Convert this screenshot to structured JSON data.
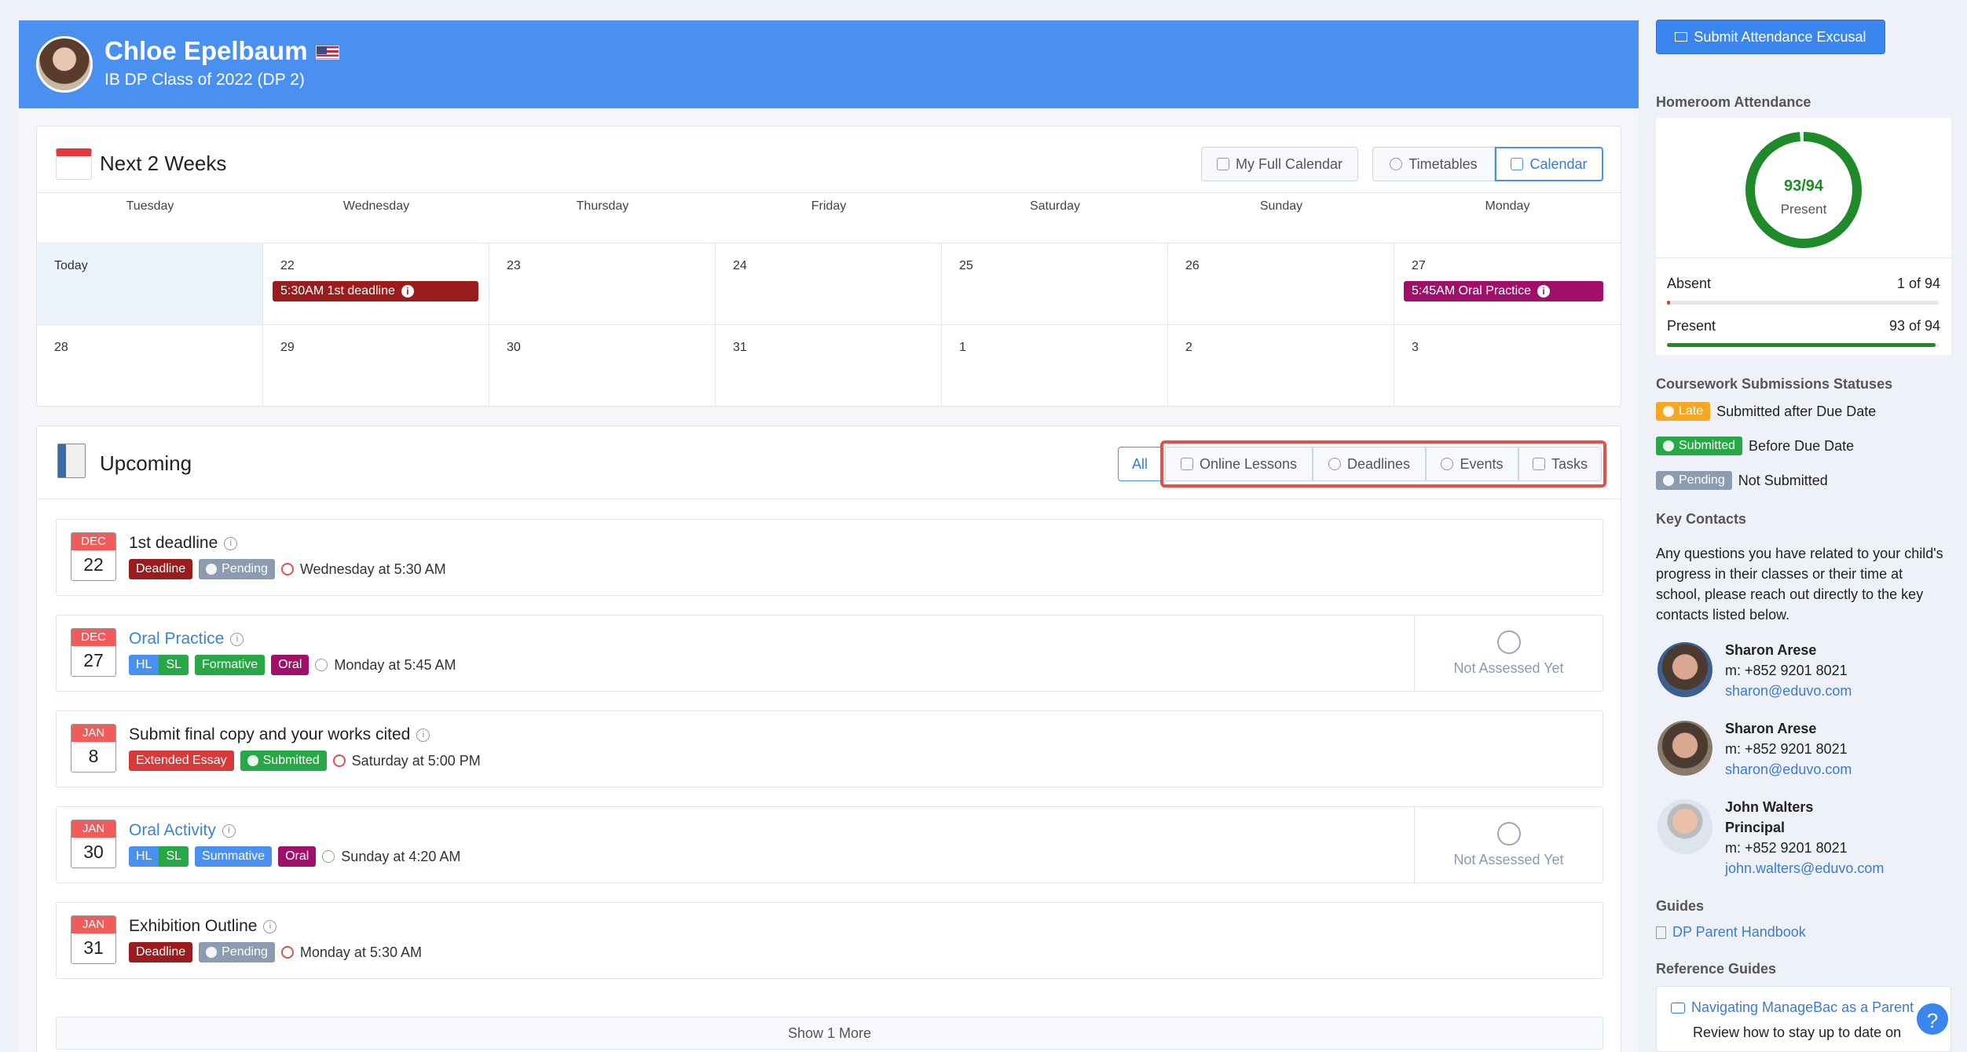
{
  "student": {
    "name": "Chloe Epelbaum",
    "class": "IB DP Class of 2022 (DP 2)"
  },
  "calendar": {
    "title": "Next 2 Weeks",
    "buttons": {
      "full_calendar": "My Full Calendar",
      "timetables": "Timetables",
      "calendar": "Calendar"
    },
    "days": [
      "Tuesday",
      "Wednesday",
      "Thursday",
      "Friday",
      "Saturday",
      "Sunday",
      "Monday"
    ],
    "week1": [
      "Today",
      "22",
      "23",
      "24",
      "25",
      "26",
      "27"
    ],
    "week2": [
      "28",
      "29",
      "30",
      "31",
      "1",
      "2",
      "3"
    ],
    "events": [
      {
        "label": "5:30AM 1st deadline",
        "color": "#9b1c1c"
      },
      {
        "label": "5:45AM Oral Practice",
        "color": "#a0106a"
      }
    ]
  },
  "upcoming": {
    "title": "Upcoming",
    "filters": {
      "all": "All",
      "online": "Online Lessons",
      "deadlines": "Deadlines",
      "events": "Events",
      "tasks": "Tasks"
    },
    "items": [
      {
        "month": "DEC",
        "day": "22",
        "title": "1st deadline",
        "tags": [
          "Deadline",
          "Pending"
        ],
        "when": "Wednesday at 5:30 AM"
      },
      {
        "month": "DEC",
        "day": "27",
        "title": "Oral Practice",
        "tags": [
          "HL",
          "SL",
          "Formative",
          "Oral"
        ],
        "when": "Monday at 5:45 AM",
        "status": "Not Assessed Yet"
      },
      {
        "month": "JAN",
        "day": "8",
        "title": "Submit final copy and your works cited",
        "tags": [
          "Extended Essay",
          "Submitted"
        ],
        "when": "Saturday at 5:00 PM"
      },
      {
        "month": "JAN",
        "day": "30",
        "title": "Oral Activity",
        "tags": [
          "HL",
          "SL",
          "Summative",
          "Oral"
        ],
        "when": "Sunday at 4:20 AM",
        "status": "Not Assessed Yet"
      },
      {
        "month": "JAN",
        "day": "31",
        "title": "Exhibition Outline",
        "tags": [
          "Deadline",
          "Pending"
        ],
        "when": "Monday at 5:30 AM"
      }
    ],
    "show_more": "Show 1 More"
  },
  "sidebar": {
    "submit_btn": "Submit Attendance Excusal",
    "attendance": {
      "heading": "Homeroom Attendance",
      "ratio": "93/94",
      "ratio_label": "Present",
      "present_fraction": 0.989,
      "absent_label": "Absent",
      "absent_value": "1 of 94",
      "present_label": "Present",
      "present_value": "93 of 94"
    },
    "coursework": {
      "heading": "Coursework Submissions Statuses",
      "rows": [
        {
          "badge": "Late",
          "text": "Submitted after Due Date",
          "color": "#f5a623"
        },
        {
          "badge": "Submitted",
          "text": "Before Due Date",
          "color": "#27a745"
        },
        {
          "badge": "Pending",
          "text": "Not Submitted",
          "color": "#8c9bb0"
        }
      ]
    },
    "contacts": {
      "heading": "Key Contacts",
      "intro": "Any questions you have related to your child's progress in their classes or their time at school, please reach out directly to the key contacts listed below.",
      "people": [
        {
          "name": "Sharon Arese",
          "role": "",
          "phone": "m: +852 9201 8021",
          "email": "sharon@eduvo.com"
        },
        {
          "name": "Sharon Arese",
          "role": "",
          "phone": "m: +852 9201 8021",
          "email": "sharon@eduvo.com"
        },
        {
          "name": "John Walters",
          "role": "Principal",
          "phone": "m: +852 9201 8021",
          "email": "john.walters@eduvo.com"
        }
      ]
    },
    "guides": {
      "heading": "Guides",
      "link": "DP Parent Handbook"
    },
    "reference": {
      "heading": "Reference Guides",
      "link": "Navigating ManageBac as a Parent",
      "desc": "Review how to stay up to date on"
    }
  },
  "colors": {
    "accent": "#4a90f0",
    "highlight": "#e0524a"
  }
}
